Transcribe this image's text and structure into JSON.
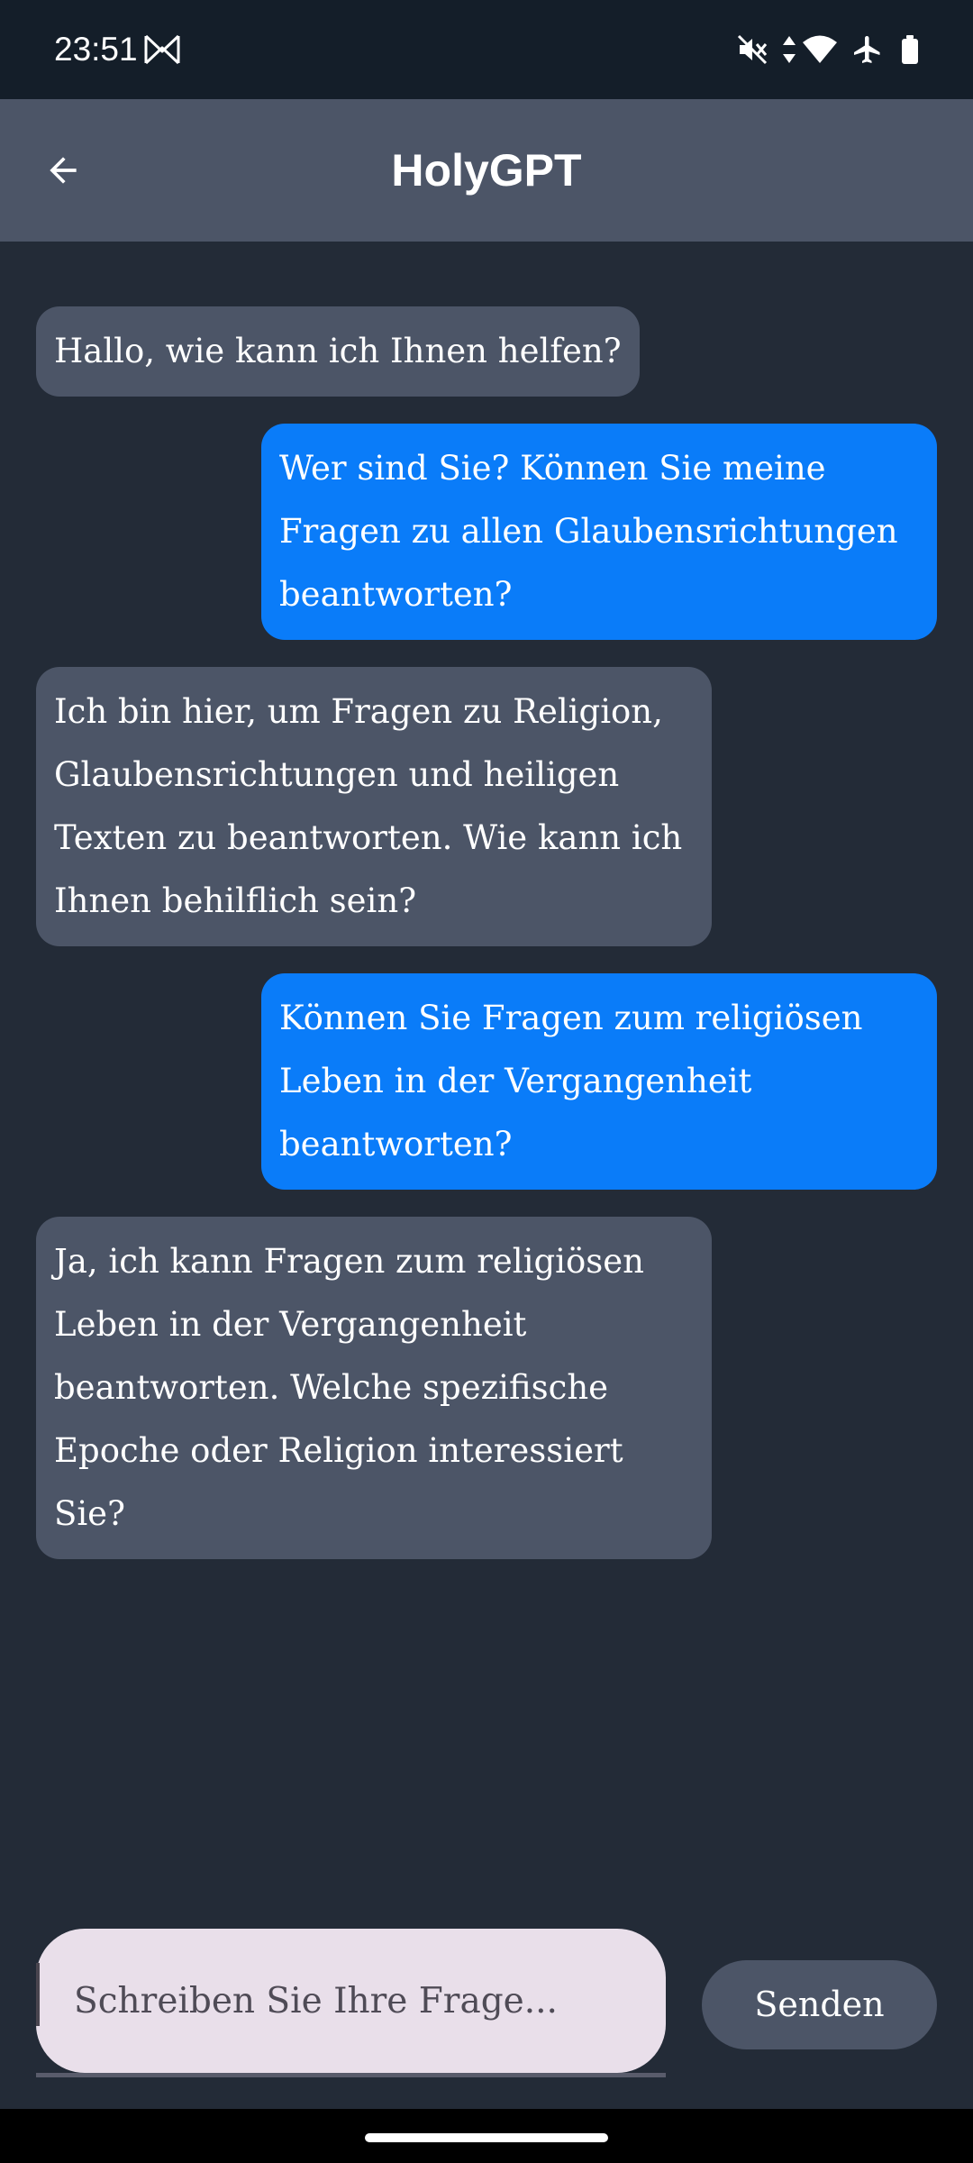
{
  "status_bar": {
    "time": "23:51",
    "icons": [
      "gmail-m-icon",
      "mute-icon",
      "data-arrows-icon",
      "wifi-icon",
      "airplane-icon",
      "battery-icon"
    ]
  },
  "app_bar": {
    "title": "HolyGPT",
    "back_icon": "arrow-back-icon"
  },
  "messages": [
    {
      "role": "bot",
      "text": "Hallo, wie kann ich Ihnen helfen?"
    },
    {
      "role": "user",
      "text": "Wer sind Sie? Können Sie meine Fragen zu allen Glaubensrichtungen beantworten?"
    },
    {
      "role": "bot",
      "text": "Ich bin hier, um Fragen zu Religion, Glaubensrichtungen und heiligen Texten zu beantworten. Wie kann ich Ihnen behilflich sein?"
    },
    {
      "role": "user",
      "text": "Können Sie Fragen zum religiösen Leben in der Vergangenheit beantworten?"
    },
    {
      "role": "bot",
      "text": "Ja, ich kann Fragen zum religiösen Leben in der Vergangenheit beantworten. Welche spezifische Epoche oder Religion interessiert Sie?"
    }
  ],
  "composer": {
    "placeholder": "Schreiben Sie Ihre Frage...",
    "value": "",
    "send_label": "Senden"
  },
  "colors": {
    "background": "#232b37",
    "status_bar": "#141e29",
    "app_bar": "#4c5567",
    "bot_bubble": "#4c5567",
    "user_bubble": "#0a7cf9",
    "input_fill": "#e9dfea"
  }
}
